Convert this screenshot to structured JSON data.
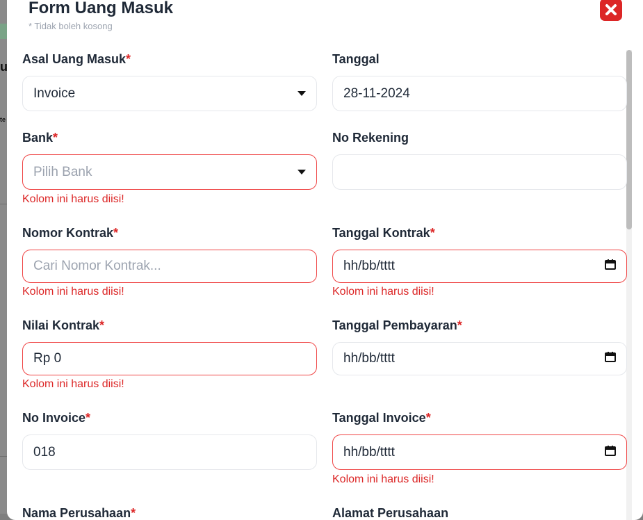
{
  "background": {
    "glyph_1": "ul",
    "glyph_2": "te"
  },
  "modal": {
    "title": "Form Uang Masuk",
    "subtitle": "* Tidak boleh kosong",
    "close_icon": "close-x-icon",
    "accent_color": "#dc2626"
  },
  "required_marker": "*",
  "fields": {
    "asal": {
      "label": "Asal Uang Masuk",
      "value": "Invoice"
    },
    "tanggal": {
      "label": "Tanggal",
      "value": "28-11-2024"
    },
    "bank": {
      "label": "Bank",
      "placeholder": "Pilih Bank",
      "error": "Kolom ini harus diisi!"
    },
    "no_rekening": {
      "label": "No Rekening",
      "value": ""
    },
    "nomor_kontrak": {
      "label": "Nomor Kontrak",
      "placeholder": "Cari Nomor Kontrak...",
      "error": "Kolom ini harus diisi!"
    },
    "tanggal_kontrak": {
      "label": "Tanggal Kontrak",
      "value": "hh/bb/tttt",
      "error": "Kolom ini harus diisi!"
    },
    "nilai_kontrak": {
      "label": "Nilai Kontrak",
      "value": "Rp 0",
      "error": "Kolom ini harus diisi!"
    },
    "tanggal_pembayaran": {
      "label": "Tanggal Pembayaran",
      "value": "hh/bb/tttt"
    },
    "no_invoice": {
      "label": "No Invoice",
      "value": "018"
    },
    "tanggal_invoice": {
      "label": "Tanggal Invoice",
      "value": "hh/bb/tttt",
      "error": "Kolom ini harus diisi!"
    },
    "nama_perusahaan": {
      "label": "Nama Perusahaan"
    },
    "alamat_perusahaan": {
      "label": "Alamat Perusahaan"
    }
  }
}
